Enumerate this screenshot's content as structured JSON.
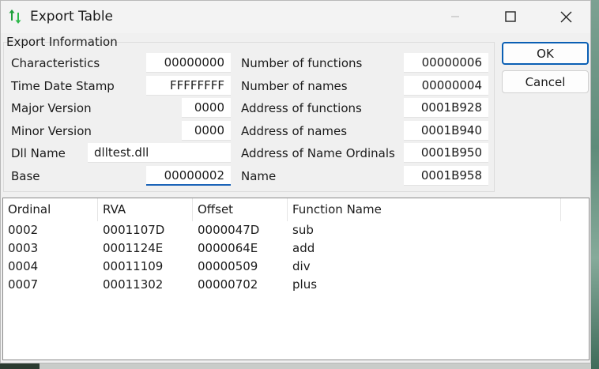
{
  "window": {
    "title": "Export Table",
    "controls": {
      "minimize_icon": "minimize-icon",
      "maximize_icon": "maximize-icon",
      "close_icon": "close-icon"
    }
  },
  "group": {
    "label": "Export Information",
    "left_fields": [
      {
        "label": "Characteristics",
        "value": "00000000"
      },
      {
        "label": "Time Date Stamp",
        "value": "FFFFFFFF"
      },
      {
        "label": "Major Version",
        "value": "0000"
      },
      {
        "label": "Minor Version",
        "value": "0000"
      },
      {
        "label": "Dll Name",
        "value": "dlltest.dll"
      },
      {
        "label": "Base",
        "value": "00000002"
      }
    ],
    "right_fields": [
      {
        "label": "Number of functions",
        "value": "00000006"
      },
      {
        "label": "Number of names",
        "value": "00000004"
      },
      {
        "label": "Address of functions",
        "value": "0001B928"
      },
      {
        "label": "Address of names",
        "value": "0001B940"
      },
      {
        "label": "Address of Name Ordinals",
        "value": "0001B950"
      },
      {
        "label": "Name",
        "value": "0001B958"
      }
    ]
  },
  "buttons": {
    "ok": "OK",
    "cancel": "Cancel"
  },
  "table": {
    "columns": [
      "Ordinal",
      "RVA",
      "Offset",
      "Function Name"
    ],
    "rows": [
      [
        "0002",
        "0001107D",
        "0000047D",
        "sub"
      ],
      [
        "0003",
        "0001124E",
        "0000064E",
        "add"
      ],
      [
        "0004",
        "00011109",
        "00000509",
        "div"
      ],
      [
        "0007",
        "00011302",
        "00000702",
        "plus"
      ]
    ]
  },
  "colors": {
    "accent": "#0a5fb4",
    "icon_up": "#1e9e3a",
    "icon_down": "#2db84a"
  }
}
